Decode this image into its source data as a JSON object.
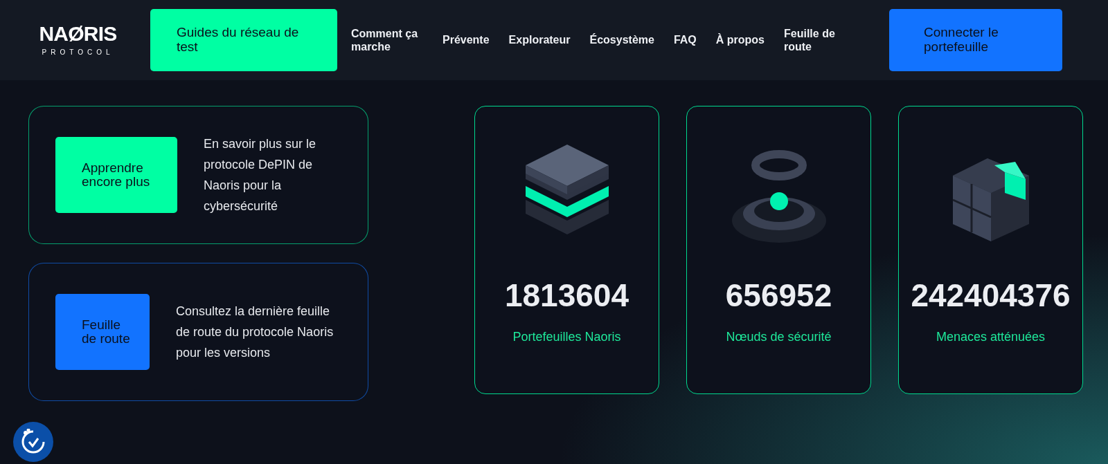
{
  "logo": {
    "name": "NAØRIS",
    "tagline": "PROTOCOL"
  },
  "nav": [
    {
      "kind": "button",
      "color": "#00ffa3",
      "label": "Guides du réseau de test"
    },
    {
      "kind": "link",
      "label": "Comment ça marche"
    },
    {
      "kind": "link",
      "label": "Prévente"
    },
    {
      "kind": "link",
      "label": "Explorateur"
    },
    {
      "kind": "link",
      "label": "Écosystème"
    },
    {
      "kind": "link",
      "label": "FAQ"
    },
    {
      "kind": "link",
      "label": "À propos"
    },
    {
      "kind": "link",
      "label": "Feuille de route"
    },
    {
      "kind": "button",
      "color": "#1273ff",
      "label": "Connecter le portefeuille"
    }
  ],
  "info_cards": [
    {
      "color": "#00ffa3",
      "button": "Apprendre encore plus",
      "text": "En savoir plus sur le protocole DePIN de Naoris pour la cybersécurité"
    },
    {
      "color": "#1273ff",
      "button": "Feuille de route",
      "text": "Consultez la dernière feuille de route du protocole Naoris pour les versions"
    }
  ],
  "stats": [
    {
      "kind": "layers",
      "value": "1813604",
      "label": "Portefeuilles Naoris"
    },
    {
      "kind": "rings",
      "value": "656952",
      "label": "Nœuds de sécurité"
    },
    {
      "kind": "cubes",
      "value": "242404376",
      "label": "Menaces atténuées"
    }
  ]
}
